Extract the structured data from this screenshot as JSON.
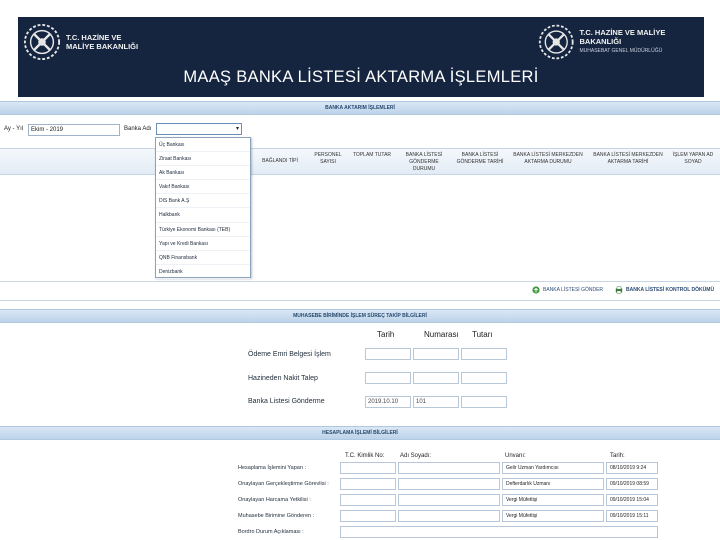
{
  "banner": {
    "left_logo_line1": "T.C. HAZİNE VE",
    "left_logo_line2": "MALİYE BAKANLIĞI",
    "right_logo_line1": "T.C. HAZİNE VE MALİYE BAKANLIĞI",
    "right_logo_line2": "MUHASEBAT GENEL MÜDÜRLÜĞÜ",
    "title": "MAAŞ BANKA LİSTESİ AKTARMA İŞLEMLERİ",
    "color": "#15253f"
  },
  "transfer_section": {
    "title": "BANKA AKTARIM İŞLEMLERİ",
    "period_label": "Ay - Yıl",
    "period_value": "Ekim - 2019",
    "bank_label": "Banka Adı",
    "bank_value": "",
    "columns": [
      "BAĞLANDI TİPİ",
      "PERSONEL SAYISI",
      "TOPLAM TUTAR",
      "BANKA LİSTESİ GÖNDERME DURUMU",
      "BANKA LİSTESİ GÖNDERME TARİHİ",
      "BANKA LİSTESİ MERKEZDEN AKTARMA DURUMU",
      "BANKA LİSTESİ MERKEZDEN AKTARMA TARİHİ",
      "İŞLEM YAPAN AD SOYAD"
    ],
    "bank_options": [
      "Üç Bankası",
      "Ziraat Bankası",
      "Ak Bankası",
      "Vakıf Bankası",
      "DIS Bank A.Ş",
      "Halkbank",
      "Türkiye Ekonomi Bankası (TEB)",
      "Yapı ve Kredi Bankası",
      "QNB Finansbank",
      "Denizbank"
    ],
    "send_button": "BANKA LİSTESİ GÖNDER",
    "print_button": "BANKA LİSTESİ KONTROL DÖKÜMÜ"
  },
  "tracking_section": {
    "title": "MUHASEBE BİRİMİNDE İŞLEM SÜREÇ TAKİP BİLGİLERİ",
    "columns": [
      "Tarih",
      "Numarası",
      "Tutarı"
    ],
    "rows": [
      {
        "label": "Ödeme Emri Belgesi İşlem",
        "date": "",
        "number": "",
        "amount": ""
      },
      {
        "label": "Hazineden Nakit Talep",
        "date": "",
        "number": "",
        "amount": ""
      },
      {
        "label": "Banka Listesi Gönderme",
        "date": "2019.10.10",
        "number": "101",
        "amount": ""
      }
    ]
  },
  "calc_section": {
    "title": "HESAPLAMA İŞLEMİ BİLGİLERİ",
    "columns": [
      "T.C. Kimlik No:",
      "Adı Soyadı:",
      "Unvanı:",
      "Tarih:"
    ],
    "rows": [
      {
        "label": "Hesaplama İşlemini Yapan :",
        "tc": "",
        "name": "",
        "title": "Gelir Uzman Yardımcısı",
        "date": "08/10/2019 9:24"
      },
      {
        "label": "Onaylayan Gerçekleştirme Görevlisi :",
        "tc": "",
        "name": "",
        "title": "Defterdarlık Uzmanı",
        "date": "09/10/2019 08:59"
      },
      {
        "label": "Onaylayan Harcama Yetkilisi :",
        "tc": "",
        "name": "",
        "title": "Vergi Müfettişi",
        "date": "09/10/2019 15:04"
      },
      {
        "label": "Muhasebe Birimine Gönderen :",
        "tc": "",
        "name": "",
        "title": "Vergi Müfettişi",
        "date": "09/10/2019 15:11"
      },
      {
        "label": "Bordro Durum Açıklaması :",
        "tc": "",
        "name": "",
        "title": "",
        "date": ""
      }
    ]
  },
  "icons": [
    "emblem-icon",
    "send-icon",
    "print-icon",
    "dropdown-arrow-icon"
  ]
}
